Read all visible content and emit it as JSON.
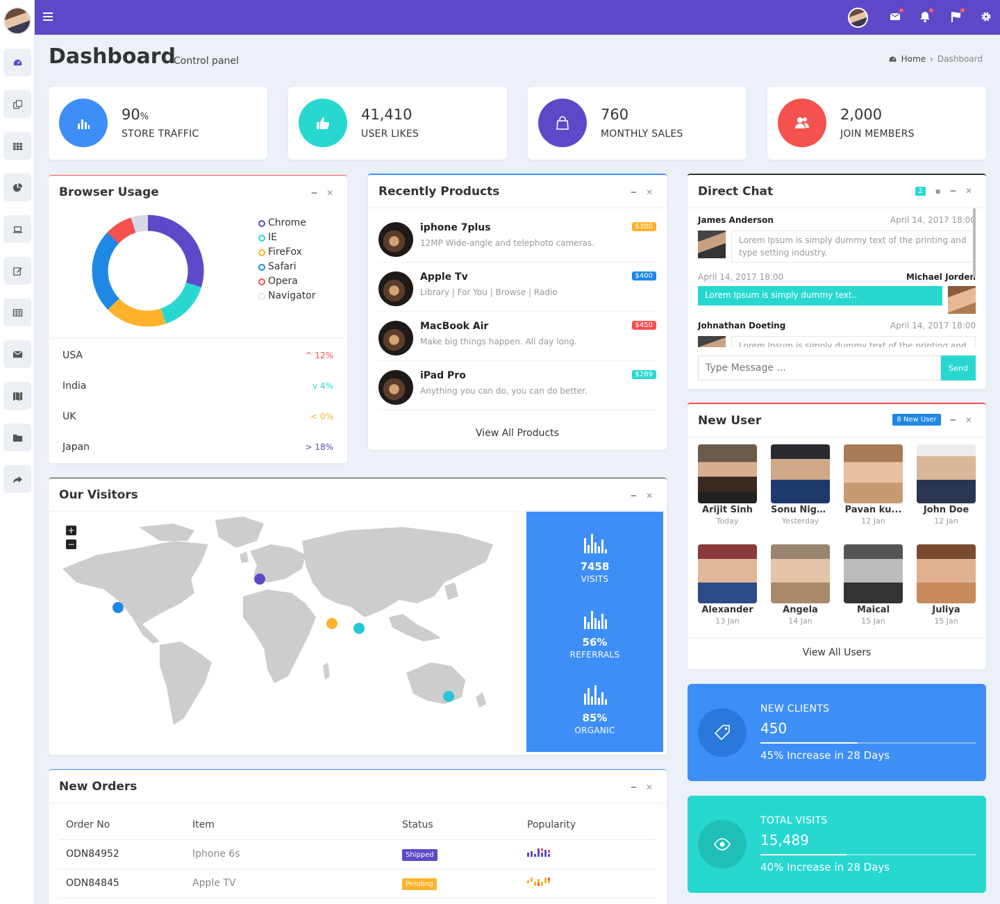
{
  "page": {
    "title": "Dashboard",
    "subtitle": "Control panel"
  },
  "breadcrumb": {
    "home": "Home",
    "current": "Dashboard"
  },
  "stats": [
    {
      "value": "90",
      "unit": "%",
      "label": "STORE TRAFFIC",
      "color": "#3e8ef7",
      "icon": "bar-chart-icon"
    },
    {
      "value": "41,410",
      "unit": "",
      "label": "USER LIKES",
      "color": "#28d8d0",
      "icon": "thumbs-up-icon"
    },
    {
      "value": "760",
      "unit": "",
      "label": "MONTHLY SALES",
      "color": "#5f48c8",
      "icon": "shopping-bag-icon"
    },
    {
      "value": "2,000",
      "unit": "",
      "label": "JOIN MEMBERS",
      "color": "#f4514f",
      "icon": "users-icon"
    }
  ],
  "browser_usage": {
    "title": "Browser Usage",
    "browsers": [
      {
        "name": "Chrome",
        "color": "#5f48c8"
      },
      {
        "name": "IE",
        "color": "#28d8d0"
      },
      {
        "name": "FireFox",
        "color": "#ffb22b"
      },
      {
        "name": "Safari",
        "color": "#1e88e5"
      },
      {
        "name": "Opera",
        "color": "#f4514f"
      },
      {
        "name": "Navigator",
        "color": "#cfd8dc"
      }
    ],
    "countries": [
      {
        "name": "USA",
        "change": "12%",
        "dir": "up",
        "color": "#f4514f"
      },
      {
        "name": "India",
        "change": "4%",
        "dir": "down",
        "color": "#28d8d0"
      },
      {
        "name": "UK",
        "change": "0%",
        "dir": "left",
        "color": "#ffb22b"
      },
      {
        "name": "Japan",
        "change": "18%",
        "dir": "right",
        "color": "#5f48c8"
      }
    ]
  },
  "products": {
    "title": "Recently Products",
    "items": [
      {
        "name": "iphone 7plus",
        "desc": "12MP Wide-angle and telephoto cameras.",
        "price": "$300",
        "color": "#ffb22b"
      },
      {
        "name": "Apple Tv",
        "desc": "Library | For You | Browse | Radio",
        "price": "$400",
        "color": "#1e88e5"
      },
      {
        "name": "MacBook Air",
        "desc": "Make big things happen. All day long.",
        "price": "$450",
        "color": "#f4514f"
      },
      {
        "name": "iPad Pro",
        "desc": "Anything you can do, you can do better.",
        "price": "$289",
        "color": "#28d8d0"
      }
    ],
    "view_all": "View All Products"
  },
  "chat": {
    "title": "Direct Chat",
    "badge": "2",
    "messages": [
      {
        "name": "James Anderson",
        "time": "April 14, 2017 18:00",
        "text": "Lorem Ipsum is simply dummy text of the printing and type setting industry."
      },
      {
        "name": "Michael Jorden",
        "time": "April 14, 2017 18:00",
        "text": "Lorem Ipsum is simply dummy text.."
      },
      {
        "name": "Johnathan Doeting",
        "time": "April 14, 2017 18:00",
        "text": "Lorem Ipsum is simply dummy text of the printing and"
      }
    ],
    "placeholder": "Type Message ...",
    "send": "Send"
  },
  "new_user": {
    "title": "New User",
    "badge": "8 New User",
    "users": [
      {
        "name": "Arijit Sinh",
        "date": "Today"
      },
      {
        "name": "Sonu Niga...",
        "date": "Yesterday"
      },
      {
        "name": "Pavan ku...",
        "date": "12 Jan"
      },
      {
        "name": "John Doe",
        "date": "12 Jan"
      },
      {
        "name": "Alexander",
        "date": "13 Jan"
      },
      {
        "name": "Angela",
        "date": "14 Jan"
      },
      {
        "name": "Maical",
        "date": "15 Jan"
      },
      {
        "name": "Juliya",
        "date": "15 Jan"
      }
    ],
    "view_all": "View All Users"
  },
  "visitors": {
    "title": "Our Visitors",
    "stats": [
      {
        "value": "7458",
        "label": "VISITS"
      },
      {
        "value": "56%",
        "label": "REFERRALS"
      },
      {
        "value": "85%",
        "label": "ORGANIC"
      }
    ],
    "zoom_in": "+",
    "zoom_out": "−"
  },
  "orders": {
    "title": "New Orders",
    "columns": [
      "Order No",
      "Item",
      "Status",
      "Popularity"
    ],
    "rows": [
      {
        "order": "ODN84952",
        "item": "Iphone 6s",
        "status": "Shipped",
        "status_color": "#5f48c8",
        "pop_color": "#5f48c8"
      },
      {
        "order": "ODN84845",
        "item": "Apple TV",
        "status": "Pending",
        "status_color": "#ffb22b",
        "pop_color": "#ffb22b"
      }
    ]
  },
  "info_boxes": [
    {
      "title": "NEW CLIENTS",
      "value": "450",
      "progress": 0.45,
      "text": "45% Increase in 28 Days",
      "color": "#3e8ef7",
      "icon": "tag-icon"
    },
    {
      "title": "TOTAL VISITS",
      "value": "15,489",
      "progress": 0.4,
      "text": "40% Increase in 28 Days",
      "color": "#28d8d0",
      "icon": "eye-icon"
    }
  ]
}
